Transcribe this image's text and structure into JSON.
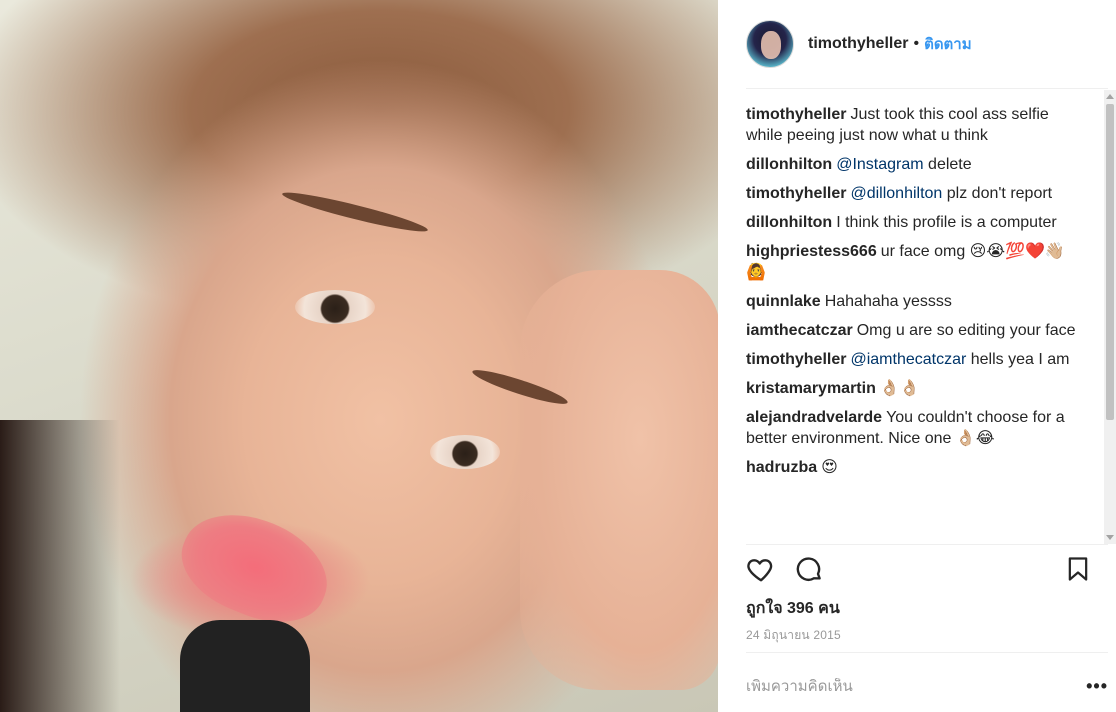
{
  "post": {
    "username": "timothyheller",
    "separator": "•",
    "follow_label": "ติดตาม",
    "likes_text": "ถูกใจ 396 คน",
    "date_text": "24 มิถุนายน 2015",
    "comment_placeholder": "เพิ่มความคิดเห็น",
    "more_label": "•••"
  },
  "comments": [
    {
      "author": "timothyheller",
      "mention": "",
      "text": "Just took this cool ass selfie while peeing just now what u think"
    },
    {
      "author": "dillonhilton",
      "mention": "@Instagram",
      "text": " delete"
    },
    {
      "author": "timothyheller",
      "mention": "@dillonhilton",
      "text": " plz don't report"
    },
    {
      "author": "dillonhilton",
      "mention": "",
      "text": "I think this profile is a computer"
    },
    {
      "author": "highpriestess666",
      "mention": "",
      "text": "ur face omg 😢😭💯❤️👋🏼 🙆"
    },
    {
      "author": "quinnlake",
      "mention": "",
      "text": "Hahahaha yessss"
    },
    {
      "author": "iamthecatczar",
      "mention": "",
      "text": "Omg u are so editing your face"
    },
    {
      "author": "timothyheller",
      "mention": "@iamthecatczar",
      "text": " hells yea I am"
    },
    {
      "author": "kristamarymartin",
      "mention": "",
      "text": "👌🏼👌🏼"
    },
    {
      "author": "alejandradvelarde",
      "mention": "",
      "text": "You couldn't choose for a better environment. Nice one 👌🏼😂"
    },
    {
      "author": "hadruzba",
      "mention": "",
      "text": "😍"
    }
  ],
  "icons": {
    "like": "heart-icon",
    "comment": "comment-bubble-icon",
    "save": "bookmark-icon",
    "more": "more-options-icon"
  },
  "colors": {
    "link": "#3897f0",
    "mention": "#003569",
    "text": "#262626",
    "muted": "#999999"
  }
}
